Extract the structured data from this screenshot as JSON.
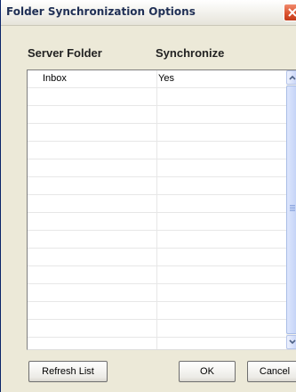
{
  "window": {
    "title": "Folder Synchronization Options"
  },
  "table": {
    "columns": [
      "Server Folder",
      "Synchronize"
    ],
    "rows": [
      {
        "folder": "Inbox",
        "synchronize": "Yes"
      }
    ]
  },
  "buttons": {
    "refresh_label": "Refresh List",
    "ok_label": "OK",
    "cancel_label": "Cancel"
  },
  "icons": {
    "close": "close-icon",
    "scroll_up": "chevron-up-icon",
    "scroll_down": "chevron-down-icon"
  },
  "colors": {
    "dialog_background": "#ece9d8",
    "close_button": "#d9502c",
    "scrollbar": "#c6d3f7"
  }
}
